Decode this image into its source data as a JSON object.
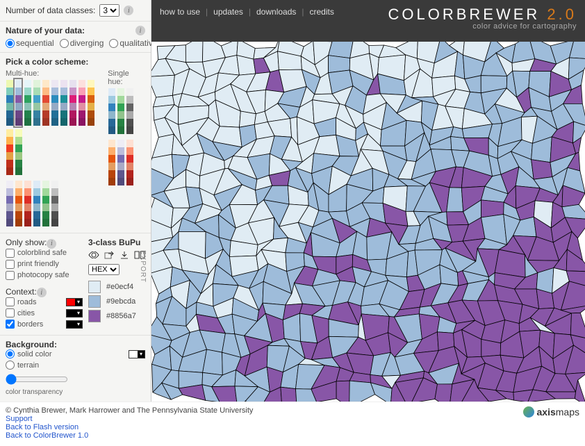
{
  "header": {
    "nav": [
      "how to use",
      "updates",
      "downloads",
      "credits"
    ],
    "brand_cb": "COLORBREWER",
    "brand_v": "2.0",
    "tagline": "color advice for cartography"
  },
  "numClasses": {
    "label": "Number of data classes:",
    "value": "3"
  },
  "nature": {
    "label": "Nature of your data:",
    "options": [
      "sequential",
      "diverging",
      "qualitative"
    ],
    "selected": "sequential"
  },
  "pick": {
    "label": "Pick a color scheme:",
    "multi": "Multi-hue:",
    "single": "Single hue:"
  },
  "onlyShow": {
    "label": "Only show:",
    "options": [
      "colorblind safe",
      "print friendly",
      "photocopy safe"
    ]
  },
  "context": {
    "label": "Context:",
    "roads": "roads",
    "cities": "cities",
    "borders": "borders",
    "roads_color": "#ff0000",
    "cities_color": "#000000",
    "borders_color": "#000000"
  },
  "background": {
    "label": "Background:",
    "solid": "solid color",
    "terrain": "terrain",
    "solid_color": "#ffffff",
    "transparency_label": "color transparency"
  },
  "scheme": {
    "title": "3-class BuPu",
    "format": "HEX",
    "export": "EXPORT",
    "colors": [
      {
        "hex": "#e0ecf4"
      },
      {
        "hex": "#9ebcda"
      },
      {
        "hex": "#8856a7"
      }
    ]
  },
  "ramps": {
    "multi_row1": [
      [
        "#edf8b1",
        "#7fcdbb",
        "#2c7fb8"
      ],
      [
        "#e0ecf4",
        "#9ebcda",
        "#8856a7"
      ],
      [
        "#e5f5f9",
        "#99d8c9",
        "#2ca25f"
      ],
      [
        "#e0f3db",
        "#a8ddb5",
        "#43a2ca"
      ],
      [
        "#fee8c8",
        "#fdbb84",
        "#e34a33"
      ],
      [
        "#ece7f2",
        "#a6bddb",
        "#2b8cbe"
      ],
      [
        "#ece2f0",
        "#a6bddb",
        "#1c9099"
      ],
      [
        "#e7e1ef",
        "#c994c7",
        "#dd1c77"
      ],
      [
        "#fde0dd",
        "#fa9fb5",
        "#c51b8a"
      ],
      [
        "#fff7bc",
        "#fec44f",
        "#d95f0e"
      ],
      [
        "#ffeda0",
        "#feb24c",
        "#f03b20"
      ],
      [
        "#f7fcb9",
        "#addd8e",
        "#31a354"
      ]
    ],
    "multi_row2": [
      [
        "#efedf5",
        "#bcbddc",
        "#756bb1"
      ],
      [
        "#fee6ce",
        "#fdae6b",
        "#e6550d"
      ],
      [
        "#fee0d2",
        "#fc9272",
        "#de2d26"
      ],
      [
        "#deebf7",
        "#9ecae1",
        "#3182bd"
      ],
      [
        "#e5f5e0",
        "#a1d99b",
        "#31a354"
      ],
      [
        "#f0f0f0",
        "#bdbdbd",
        "#636363"
      ]
    ],
    "single": [
      [
        "#deebf7",
        "#9ecae1",
        "#3182bd"
      ],
      [
        "#e5f5e0",
        "#a1d99b",
        "#31a354"
      ],
      [
        "#f0f0f0",
        "#bdbdbd",
        "#636363"
      ],
      [
        "#fee6ce",
        "#fdae6b",
        "#e6550d"
      ],
      [
        "#efedf5",
        "#bcbddc",
        "#756bb1"
      ],
      [
        "#fee0d2",
        "#fc9272",
        "#de2d26"
      ]
    ]
  },
  "footer": {
    "copyright": "© Cynthia Brewer, Mark Harrower and The Pennsylvania State University",
    "support": "Support",
    "flash": "Back to Flash version",
    "v1": "Back to ColorBrewer 1.0",
    "axis_pre": "axis",
    "axis_post": "maps"
  }
}
